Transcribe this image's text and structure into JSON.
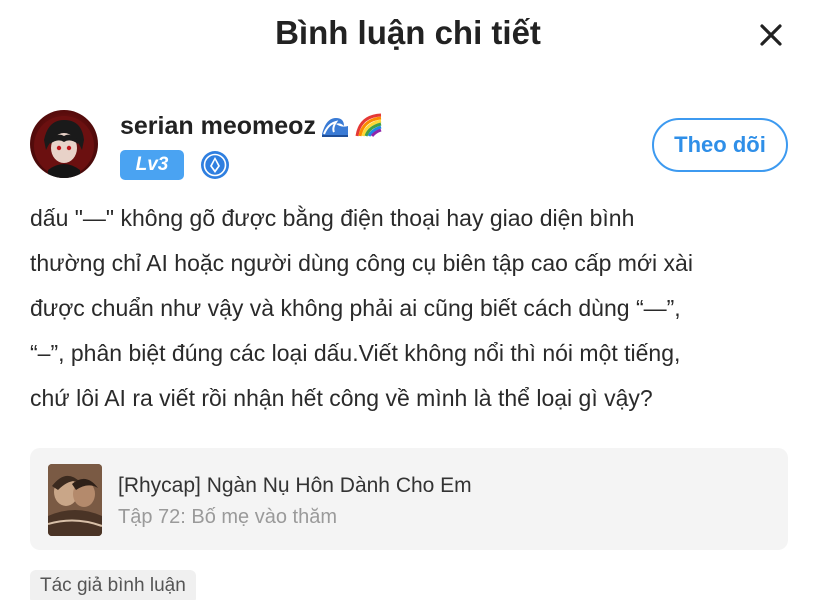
{
  "header": {
    "title": "Bình luận chi tiết",
    "close_icon": "close-icon"
  },
  "author": {
    "avatar_icon": "avatar",
    "username": "serian meomeoz",
    "username_emoji": [
      "wave-emoji",
      "rainbow-emoji"
    ],
    "level": "Lv3",
    "rank_icon": "rank-badge-icon",
    "follow_label": "Theo dõi"
  },
  "comment": {
    "lines": [
      "dấu \"—\" không gõ được bằng điện thoại hay giao diện bình",
      "thường chỉ AI hoặc người dùng công cụ biên tập cao cấp mới xài",
      "được chuẩn như vậy và không phải ai cũng biết cách dùng “—”,",
      "“–”, phân biệt đúng các loại dấu.Viết không nổi thì nói một tiếng,",
      "chứ lôi AI ra viết rồi nhận hết công về mình là thể loại gì vậy?"
    ]
  },
  "story": {
    "thumbnail": "story-cover-thumbnail",
    "title": "[Rhycap] Ngàn Nụ Hôn Dành Cho Em",
    "chapter": "Tập 72: Bố mẹ vào thăm"
  },
  "tag": {
    "label": "Tác giả bình luận"
  },
  "colors": {
    "accent": "#3d9af0",
    "level_badge": "#4aa3f2",
    "card_bg": "#f4f4f4",
    "muted_text": "#9a9a9a"
  }
}
